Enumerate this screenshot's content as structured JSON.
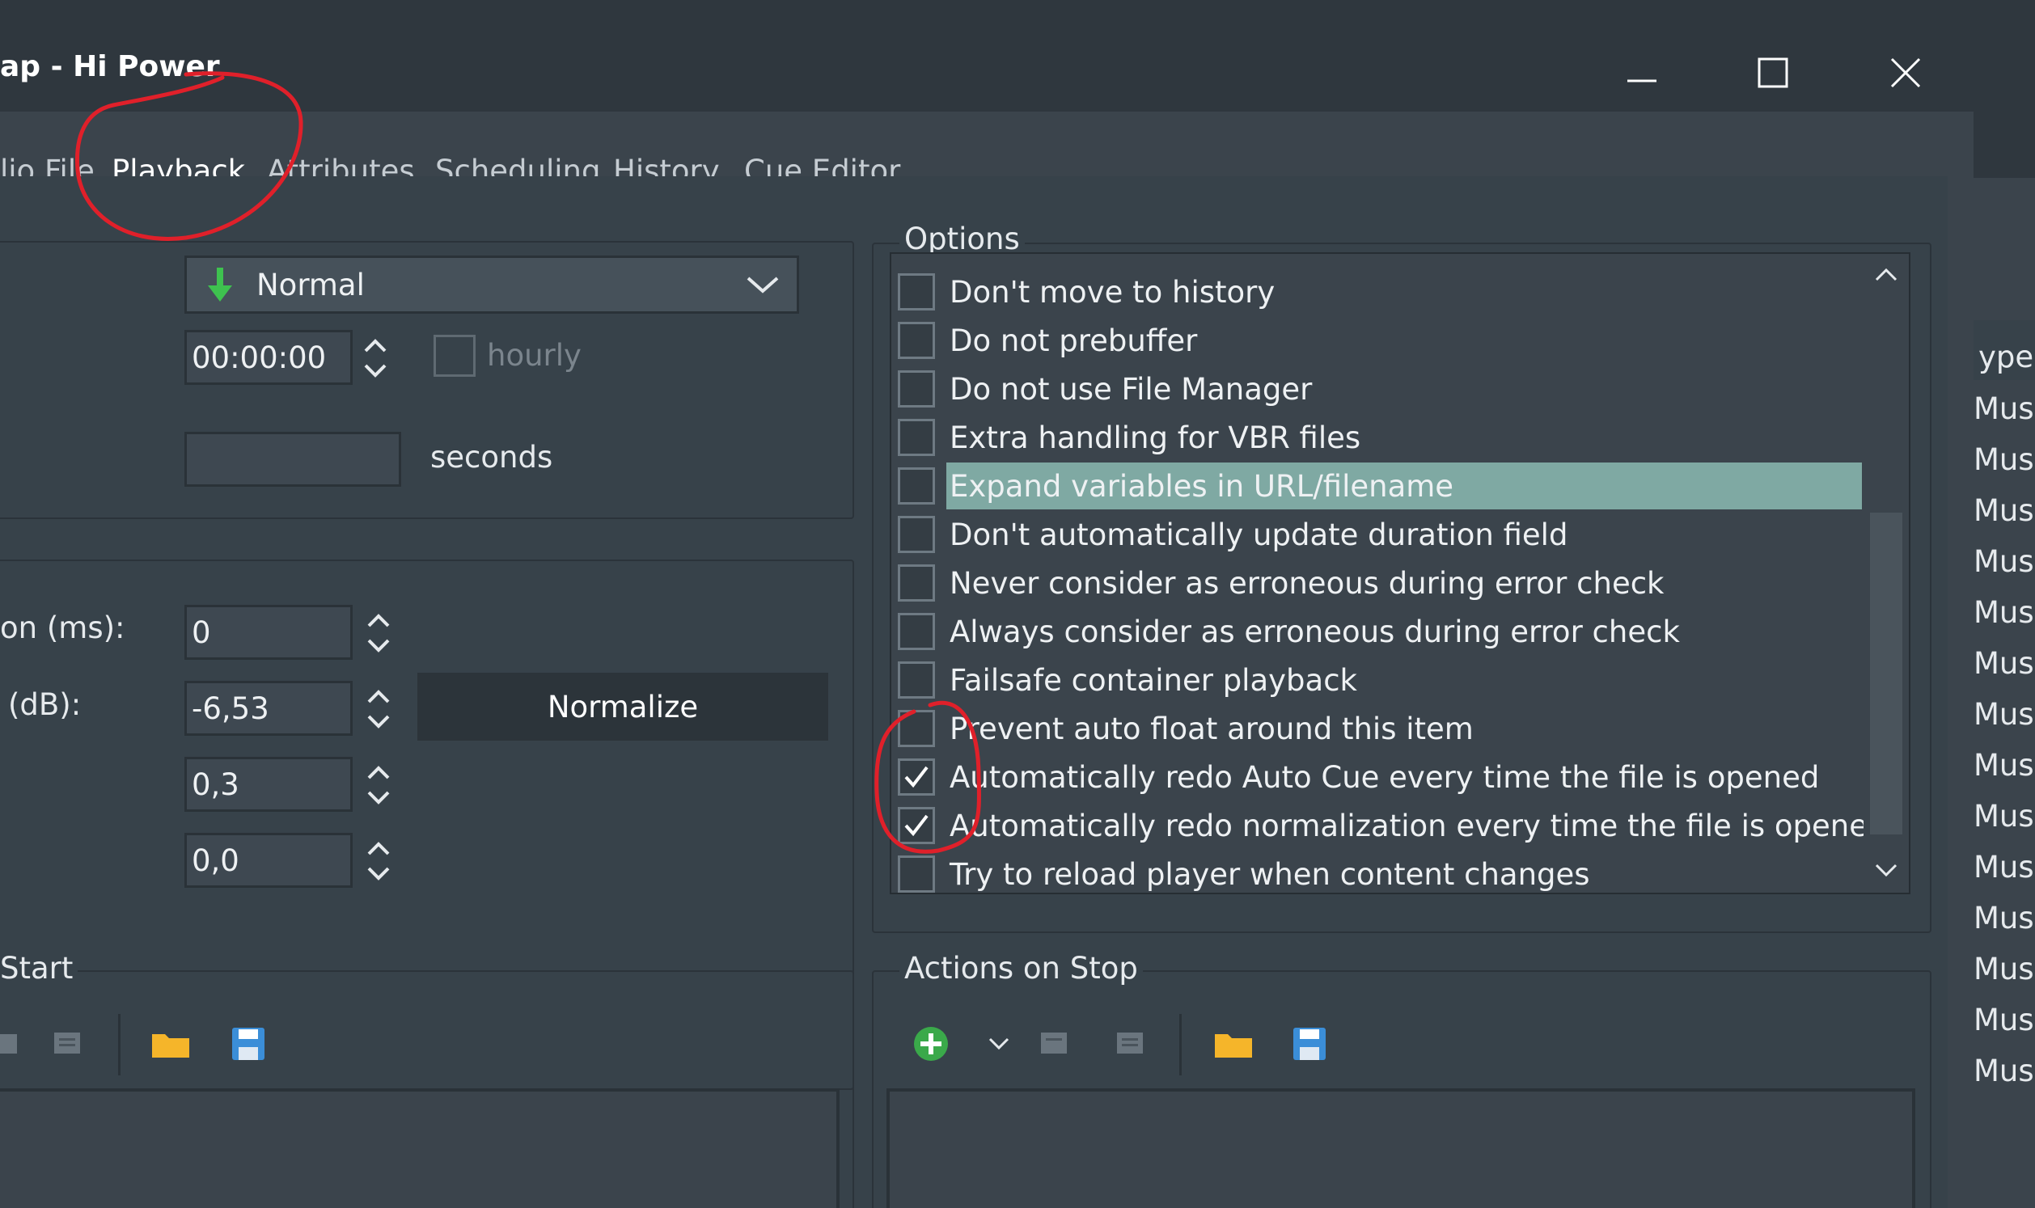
{
  "window": {
    "title": "ap - Hi Power",
    "controls": {
      "minimize": "minimize",
      "maximize": "maximize",
      "close": "close"
    }
  },
  "tabs": [
    {
      "label": "lio File",
      "active": false
    },
    {
      "label": "Playback",
      "active": true
    },
    {
      "label": "Attributes",
      "active": false
    },
    {
      "label": "Scheduling",
      "active": false
    },
    {
      "label": "History",
      "active": false
    },
    {
      "label": "Cue Editor",
      "active": false
    }
  ],
  "playback": {
    "mode_select": {
      "value": "Normal",
      "icon": "arrow-down-green-icon"
    },
    "time_field": {
      "value": "00:00:00"
    },
    "hourly_label": "hourly",
    "hourly_checked": false,
    "seconds_field": {
      "value": ""
    },
    "seconds_label": "seconds"
  },
  "levels": {
    "rows": [
      {
        "label": "on (ms):",
        "value": "0"
      },
      {
        "label": "(dB):",
        "value": "-6,53"
      },
      {
        "label": "",
        "value": "0,3"
      },
      {
        "label": "",
        "value": "0,0"
      }
    ],
    "normalize_button": "Normalize"
  },
  "options": {
    "legend": "Options",
    "items": [
      {
        "label": "Don't move to history",
        "checked": false,
        "highlighted": false
      },
      {
        "label": "Do not prebuffer",
        "checked": false,
        "highlighted": false
      },
      {
        "label": "Do not use File Manager",
        "checked": false,
        "highlighted": false
      },
      {
        "label": "Extra handling for VBR files",
        "checked": false,
        "highlighted": false
      },
      {
        "label": "Expand variables in URL/filename",
        "checked": false,
        "highlighted": true
      },
      {
        "label": "Don't automatically update duration field",
        "checked": false,
        "highlighted": false
      },
      {
        "label": "Never consider as erroneous during error check",
        "checked": false,
        "highlighted": false
      },
      {
        "label": "Always consider as erroneous during error check",
        "checked": false,
        "highlighted": false
      },
      {
        "label": "Failsafe container playback",
        "checked": false,
        "highlighted": false
      },
      {
        "label": "Prevent auto float around this item",
        "checked": false,
        "highlighted": false
      },
      {
        "label": "Automatically redo Auto Cue every time the file is opened",
        "checked": true,
        "highlighted": false
      },
      {
        "label": "Automatically redo normalization every time the file is opened",
        "checked": true,
        "highlighted": false
      },
      {
        "label": "Try to reload player when content changes",
        "checked": false,
        "highlighted": false
      }
    ]
  },
  "actions_start": {
    "legend": "Start"
  },
  "actions_stop": {
    "legend": "Actions on Stop"
  },
  "right_strip": {
    "header": "ype",
    "rows": [
      "Music",
      "Music",
      "Music",
      "Music",
      "Music",
      "Music",
      "Music",
      "Music",
      "Music",
      "Music",
      "Music",
      "Music",
      "Music",
      "Music"
    ]
  },
  "colors": {
    "accent": "#7fa9a3",
    "annotation_red": "#e0202a",
    "folder_yellow": "#f5b52a",
    "save_blue": "#3b8ed8",
    "add_green": "#3aa94a"
  }
}
